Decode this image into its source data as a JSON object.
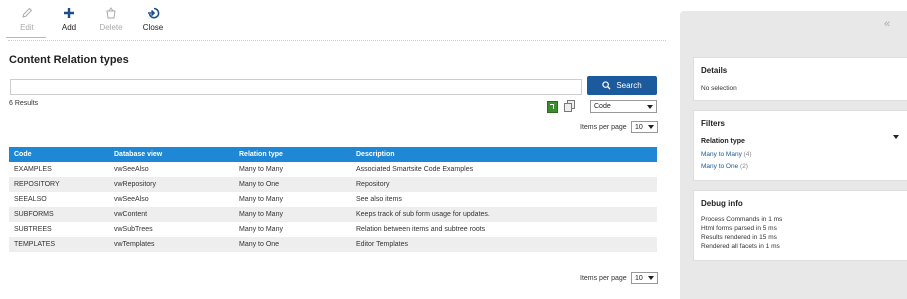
{
  "toolbar": {
    "edit": "Edit",
    "add": "Add",
    "delete": "Delete",
    "close": "Close"
  },
  "page_title": "Content Relation types",
  "search": {
    "value": "",
    "button": "Search"
  },
  "results_text": "6 Results",
  "sort_select": "Code",
  "items_per_page_label": "Items per page",
  "items_per_page_value": "10",
  "table": {
    "headers": [
      "Code",
      "Database view",
      "Relation type",
      "Description"
    ],
    "rows": [
      [
        "EXAMPLES",
        "vwSeeAlso",
        "Many to Many",
        "Associated Smartsite Code Examples"
      ],
      [
        "REPOSITORY",
        "vwRepository",
        "Many to One",
        "Repository"
      ],
      [
        "SEEALSO",
        "vwSeeAlso",
        "Many to Many",
        "See also items"
      ],
      [
        "SUBFORMS",
        "vwContent",
        "Many to Many",
        "Keeps track of sub form usage for updates."
      ],
      [
        "SUBTREES",
        "vwSubTrees",
        "Many to Many",
        "Relation between items and subtree roots"
      ],
      [
        "TEMPLATES",
        "vwTemplates",
        "Many to One",
        "Editor Templates"
      ]
    ]
  },
  "sidebar": {
    "collapse_icon": "«",
    "details": {
      "title": "Details",
      "text": "No selection"
    },
    "filters": {
      "title": "Filters",
      "group": "Relation type",
      "facets": [
        {
          "label": "Many to Many",
          "count": "(4)"
        },
        {
          "label": "Many to One",
          "count": "(2)"
        }
      ]
    },
    "debug": {
      "title": "Debug info",
      "lines": [
        "Process Commands in 1 ms",
        "Html forms parsed in 5 ms",
        "Results rendered in 15 ms",
        "Rendered all facets in 1 ms"
      ]
    }
  },
  "colors": {
    "primary": "#1b5a9d",
    "table_header": "#1e88d6",
    "sidebar_bg": "#e8e8e8"
  }
}
